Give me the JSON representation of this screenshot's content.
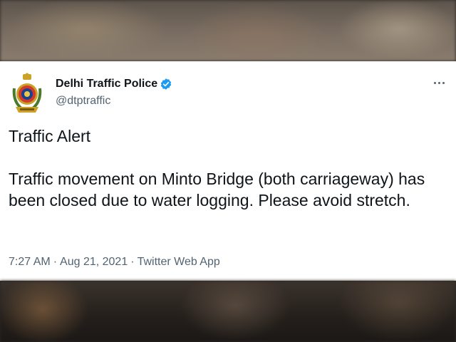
{
  "tweet": {
    "author": {
      "display_name": "Delhi Traffic Police",
      "handle": "@dtptraffic",
      "verified": true,
      "avatar_icon": "delhi-police-emblem-icon"
    },
    "more_icon": "more-dots-icon",
    "text": "Traffic Alert\n\nTraffic movement on Minto Bridge (both carriageway) has been closed due to water logging. Please avoid stretch.",
    "time": "7:27 AM",
    "date": "Aug 21, 2021",
    "source": "Twitter Web App",
    "separator": "·"
  },
  "colors": {
    "text_primary": "#0f1419",
    "text_secondary": "#536471",
    "verified_blue": "#1d9bf0",
    "card_bg": "#ffffff"
  }
}
